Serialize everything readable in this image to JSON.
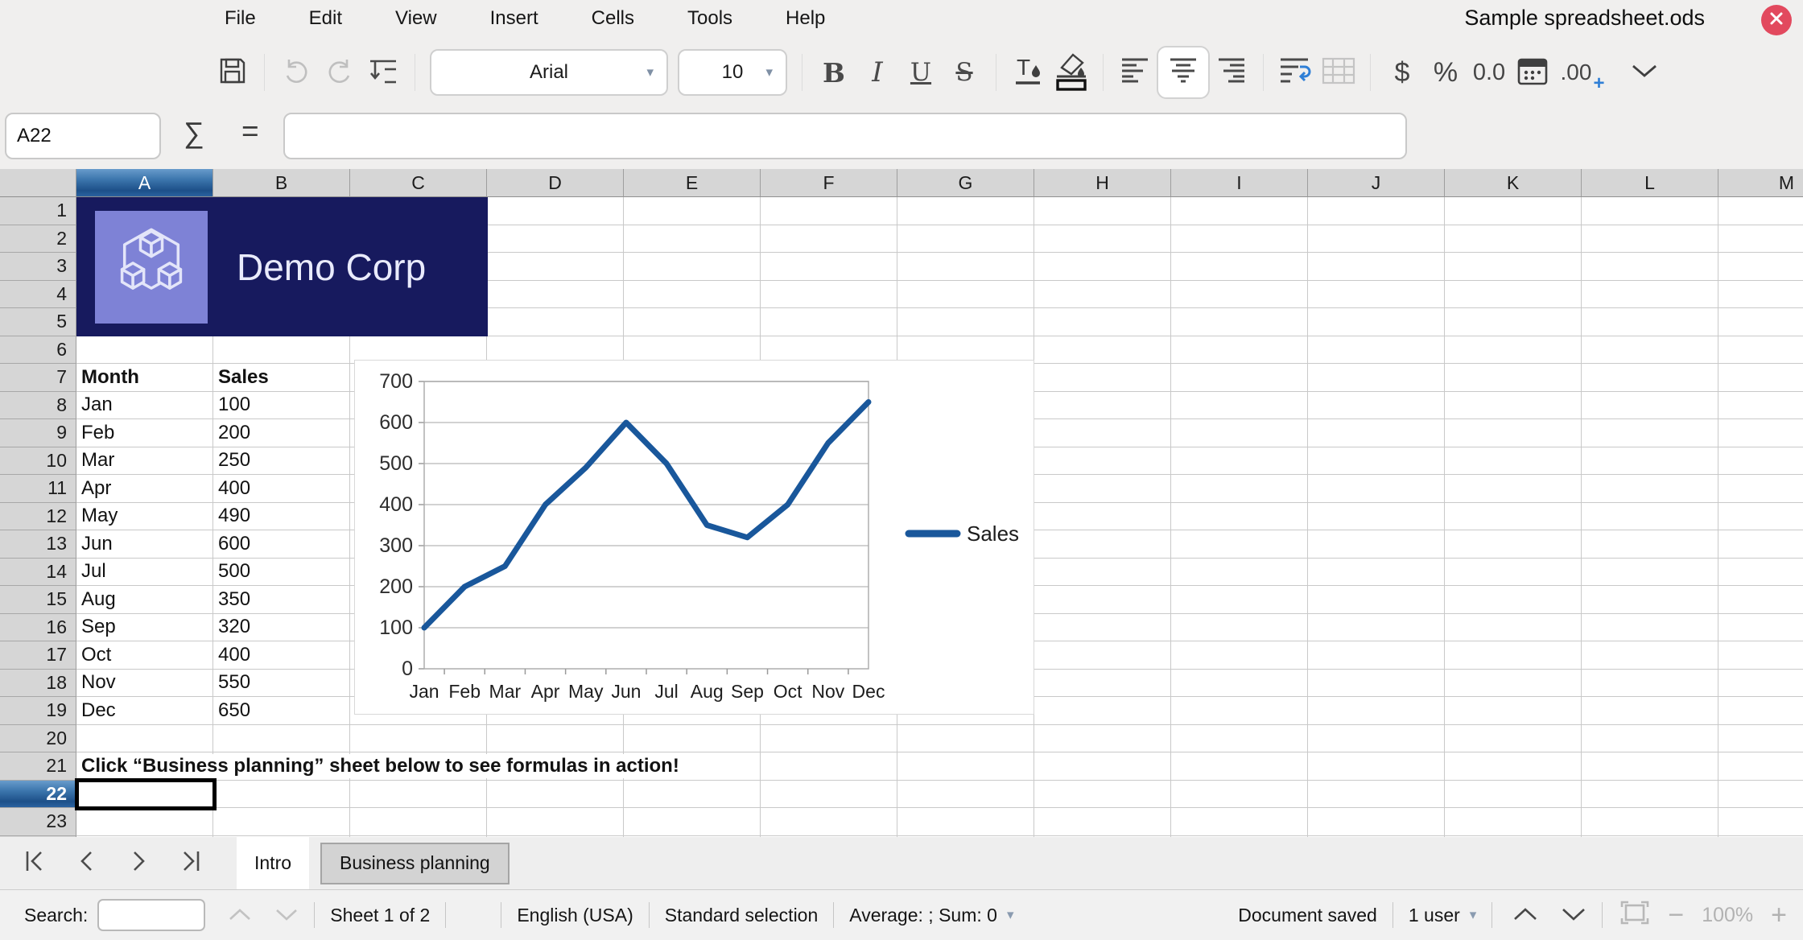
{
  "window": {
    "title": "Sample spreadsheet.ods"
  },
  "menu_bar": {
    "items": [
      "File",
      "Edit",
      "View",
      "Insert",
      "Cells",
      "Tools",
      "Help"
    ]
  },
  "toolbar": {
    "font_name": "Arial",
    "font_size": "10",
    "bold_label": "B",
    "italic_label": "I",
    "underline_label": "U",
    "strikethrough_label": "S",
    "currency_label": "$",
    "percent_label": "%",
    "number_label": "0.0",
    "decimal_label": ".00",
    "decimal_plus_label": "+"
  },
  "formula_bar": {
    "cell_reference": "A22",
    "sigma": "∑",
    "equals": "=",
    "formula_value": ""
  },
  "grid": {
    "column_headers": [
      "A",
      "B",
      "C",
      "D",
      "E",
      "F",
      "G",
      "H",
      "I",
      "J",
      "K",
      "L",
      "M"
    ],
    "row_count": 24,
    "selected_column": "A",
    "selected_row": 22,
    "selected_cell": "A22",
    "banner": {
      "title": "Demo Corp"
    },
    "table": {
      "header_row": 7,
      "start_row": 8,
      "headers": [
        "Month",
        "Sales"
      ],
      "rows": [
        [
          "Jan",
          "100"
        ],
        [
          "Feb",
          "200"
        ],
        [
          "Mar",
          "250"
        ],
        [
          "Apr",
          "400"
        ],
        [
          "May",
          "490"
        ],
        [
          "Jun",
          "600"
        ],
        [
          "Jul",
          "500"
        ],
        [
          "Aug",
          "350"
        ],
        [
          "Sep",
          "320"
        ],
        [
          "Oct",
          "400"
        ],
        [
          "Nov",
          "550"
        ],
        [
          "Dec",
          "650"
        ]
      ]
    },
    "note": {
      "row": 21,
      "text": "Click “Business planning” sheet below to see formulas in action!"
    }
  },
  "chart_data": {
    "type": "line",
    "categories": [
      "Jan",
      "Feb",
      "Mar",
      "Apr",
      "May",
      "Jun",
      "Jul",
      "Aug",
      "Sep",
      "Oct",
      "Nov",
      "Dec"
    ],
    "series": [
      {
        "name": "Sales",
        "values": [
          100,
          200,
          250,
          400,
          490,
          600,
          500,
          350,
          320,
          400,
          550,
          650
        ],
        "color": "#19579b"
      }
    ],
    "title": "",
    "xlabel": "",
    "ylabel": "",
    "ylim": [
      0,
      700
    ],
    "ytick_step": 100,
    "grid": true,
    "legend_position": "right"
  },
  "sheet_tabs": {
    "tabs": [
      {
        "label": "Intro",
        "active": true
      },
      {
        "label": "Business planning",
        "active": false
      }
    ]
  },
  "status_bar": {
    "search_label": "Search:",
    "search_value": "",
    "sheet_info": "Sheet 1 of 2",
    "language": "English (USA)",
    "selection_mode": "Standard selection",
    "aggregate": "Average: ; Sum: 0",
    "document_status": "Document saved",
    "users": "1 user",
    "zoom_level": "100%",
    "zoom_minus": "−",
    "zoom_plus": "+"
  },
  "colors": {
    "accent_line": "#19579b",
    "banner_bg": "#171a5e",
    "banner_logo_bg": "#7e82d6",
    "close_red": "#e2495e",
    "selected_header_blue": "#1d5089"
  }
}
